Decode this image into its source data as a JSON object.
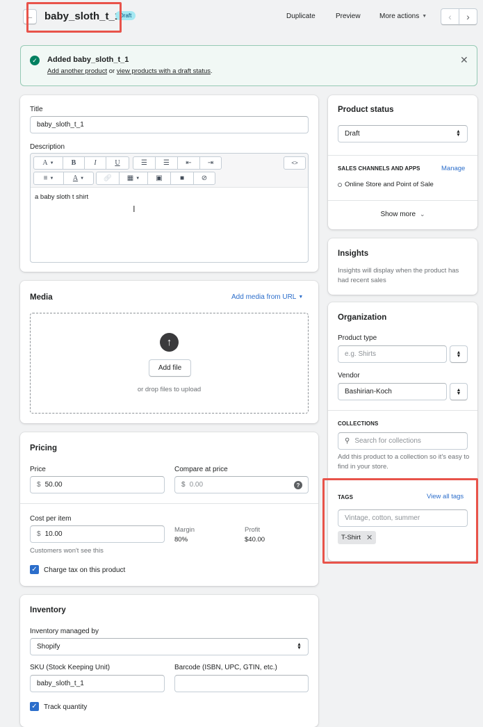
{
  "header": {
    "title": "baby_sloth_t_1",
    "badge": "Draft",
    "duplicate": "Duplicate",
    "preview": "Preview",
    "more_actions": "More actions"
  },
  "banner": {
    "title": "Added baby_sloth_t_1",
    "link1": "Add another product",
    "or": " or ",
    "link2": "view products with a draft status",
    "period": ".",
    "color": "#008060"
  },
  "product": {
    "title_label": "Title",
    "title_value": "baby_sloth_t_1",
    "description_label": "Description",
    "description_text": "a baby sloth t shirt",
    "toolbar": {
      "font_btn": "A",
      "bold": "B",
      "italic": "I",
      "underline": "U",
      "code": "<>"
    }
  },
  "media": {
    "title": "Media",
    "add_url": "Add media from URL",
    "add_file": "Add file",
    "drop_hint": "or drop files to upload"
  },
  "pricing": {
    "title": "Pricing",
    "price_label": "Price",
    "price_currency": "$",
    "price_value": "50.00",
    "compare_label": "Compare at price",
    "compare_currency": "$",
    "compare_placeholder": "0.00",
    "cost_label": "Cost per item",
    "cost_currency": "$",
    "cost_value": "10.00",
    "margin_label": "Margin",
    "margin_value": "80%",
    "profit_label": "Profit",
    "profit_value": "$40.00",
    "cost_hint": "Customers won't see this",
    "charge_tax": "Charge tax on this product",
    "charge_tax_checked": true
  },
  "inventory": {
    "title": "Inventory",
    "managed_label": "Inventory managed by",
    "managed_value": "Shopify",
    "sku_label": "SKU (Stock Keeping Unit)",
    "sku_value": "baby_sloth_t_1",
    "barcode_label": "Barcode (ISBN, UPC, GTIN, etc.)",
    "barcode_value": "",
    "track_quantity": "Track quantity"
  },
  "status": {
    "title": "Product status",
    "value": "Draft",
    "channels_heading": "SALES CHANNELS AND APPS",
    "manage": "Manage",
    "channel": "Online Store and Point of Sale",
    "show_more": "Show more"
  },
  "insights": {
    "title": "Insights",
    "text": "Insights will display when the product has had recent sales"
  },
  "organization": {
    "title": "Organization",
    "type_label": "Product type",
    "type_placeholder": "e.g. Shirts",
    "vendor_label": "Vendor",
    "vendor_value": "Bashirian-Koch",
    "collections_heading": "COLLECTIONS",
    "collections_placeholder": "Search for collections",
    "collections_hint": "Add this product to a collection so it's easy to find in your store.",
    "tags_heading": "TAGS",
    "view_all_tags": "View all tags",
    "tags_placeholder": "Vintage, cotton, summer",
    "tags": [
      "T-Shirt"
    ]
  }
}
